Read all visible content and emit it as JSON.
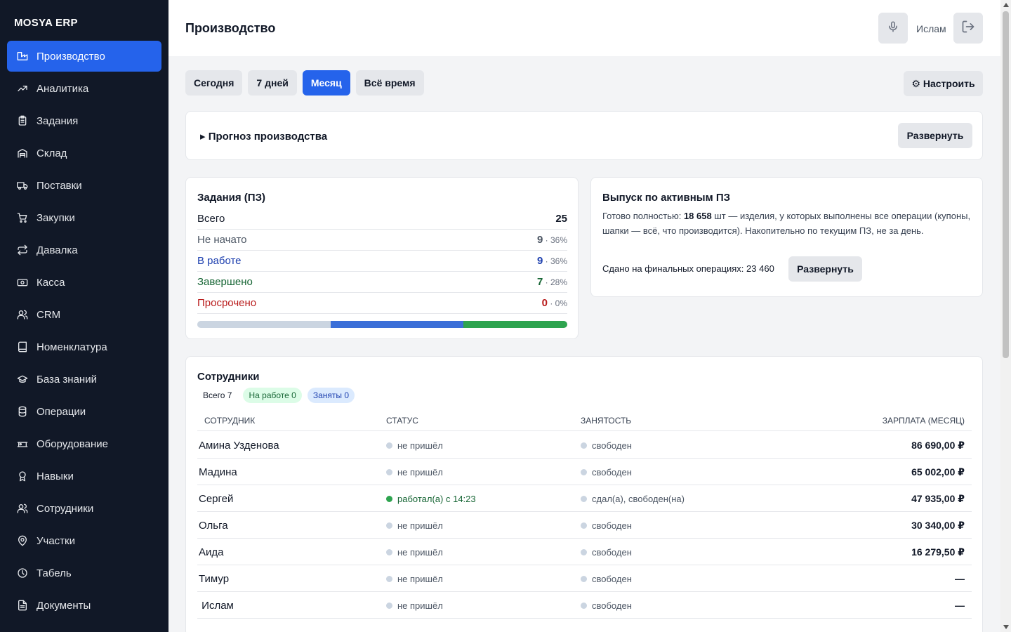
{
  "brand": "MOSYA ERP",
  "sidebar": {
    "items": [
      {
        "label": "Производство",
        "icon": "factory-icon",
        "active": true
      },
      {
        "label": "Аналитика",
        "icon": "trend-icon"
      },
      {
        "label": "Задания",
        "icon": "clipboard-icon"
      },
      {
        "label": "Склад",
        "icon": "warehouse-icon"
      },
      {
        "label": "Поставки",
        "icon": "truck-icon"
      },
      {
        "label": "Закупки",
        "icon": "cart-icon"
      },
      {
        "label": "Давалка",
        "icon": "exchange-icon"
      },
      {
        "label": "Касса",
        "icon": "cash-icon"
      },
      {
        "label": "CRM",
        "icon": "users-icon"
      },
      {
        "label": "Номенклатура",
        "icon": "book-icon"
      },
      {
        "label": "База знаний",
        "icon": "graduation-cap-icon"
      },
      {
        "label": "Операции",
        "icon": "database-icon"
      },
      {
        "label": "Оборудование",
        "icon": "machine-icon"
      },
      {
        "label": "Навыки",
        "icon": "award-icon"
      },
      {
        "label": "Сотрудники",
        "icon": "users-icon"
      },
      {
        "label": "Участки",
        "icon": "map-pin-icon"
      },
      {
        "label": "Табель",
        "icon": "clock-icon"
      },
      {
        "label": "Документы",
        "icon": "document-icon"
      }
    ]
  },
  "header": {
    "title": "Производство",
    "user": "Ислам"
  },
  "periods": {
    "tabs": [
      "Сегодня",
      "7 дней",
      "Месяц",
      "Всё время"
    ],
    "active_index": 2,
    "configure": "⚙ Настроить"
  },
  "forecast": {
    "title": "▸ Прогноз производства",
    "expand": "Развернуть"
  },
  "tasks": {
    "title": "Задания (ПЗ)",
    "total_label": "Всего",
    "total": "25",
    "rows": [
      {
        "label": "Не начато",
        "count": "9",
        "pct": " · 36%",
        "color": "#4b5563"
      },
      {
        "label": "В работе",
        "count": "9",
        "pct": " · 36%",
        "color": "#1e40af"
      },
      {
        "label": "Завершено",
        "count": "7",
        "pct": " · 28%",
        "color": "#166534"
      },
      {
        "label": "Просрочено",
        "count": "0",
        "pct": " · 0%",
        "color": "#b91c1c"
      }
    ],
    "progress": [
      {
        "name": "not-started",
        "fraction": 0.36,
        "color": "#cbd5e1"
      },
      {
        "name": "in-progress",
        "fraction": 0.36,
        "color": "#3b6fd8"
      },
      {
        "name": "completed",
        "fraction": 0.28,
        "color": "#2ea44f"
      }
    ]
  },
  "output": {
    "title": "Выпуск по активным ПЗ",
    "ready_label": "Готово полностью:",
    "ready_value": "18 658",
    "ready_unit": "шт",
    "description": " — изделия, у которых выполнены все операции (купоны, шапки — всё, что производится). Накопительно по текущим ПЗ, не за день.",
    "handed": "Сдано на финальных операциях: 23 460",
    "expand": "Развернуть"
  },
  "staff": {
    "title": "Сотрудники",
    "chips": {
      "total": "Всего 7",
      "at_work": "На работе 0",
      "busy": "Заняты 0"
    },
    "columns": [
      "СОТРУДНИК",
      "СТАТУС",
      "ЗАНЯТОСТЬ",
      "ЗАРПЛАТА (МЕСЯЦ)"
    ],
    "rows": [
      {
        "name": "Амина Узденова",
        "status": "не пришёл",
        "busy": "свободен",
        "salary": "86 690,00 ₽",
        "status_color": "#cbd5e1"
      },
      {
        "name": "Мадина",
        "status": "не пришёл",
        "busy": "свободен",
        "salary": "65 002,00 ₽",
        "status_color": "#cbd5e1"
      },
      {
        "name": "Сергей",
        "status": "работал(а) с 14:23",
        "busy": "сдал(а), свободен(на)",
        "salary": "47 935,00 ₽",
        "status_color": "#2ea44f"
      },
      {
        "name": "Ольга",
        "status": "не пришёл",
        "busy": "свободен",
        "salary": "30 340,00 ₽",
        "status_color": "#cbd5e1"
      },
      {
        "name": "Аида",
        "status": "не пришёл",
        "busy": "свободен",
        "salary": "16 279,50 ₽",
        "status_color": "#cbd5e1"
      },
      {
        "name": "Тимур",
        "status": "не пришёл",
        "busy": "свободен",
        "salary": "—",
        "status_color": "#cbd5e1"
      },
      {
        "name": " Ислам",
        "status": "не пришёл",
        "busy": "свободен",
        "salary": "—",
        "status_color": "#cbd5e1"
      }
    ]
  },
  "colors": {
    "sidebar_bg": "#111827",
    "accent": "#2563eb"
  }
}
